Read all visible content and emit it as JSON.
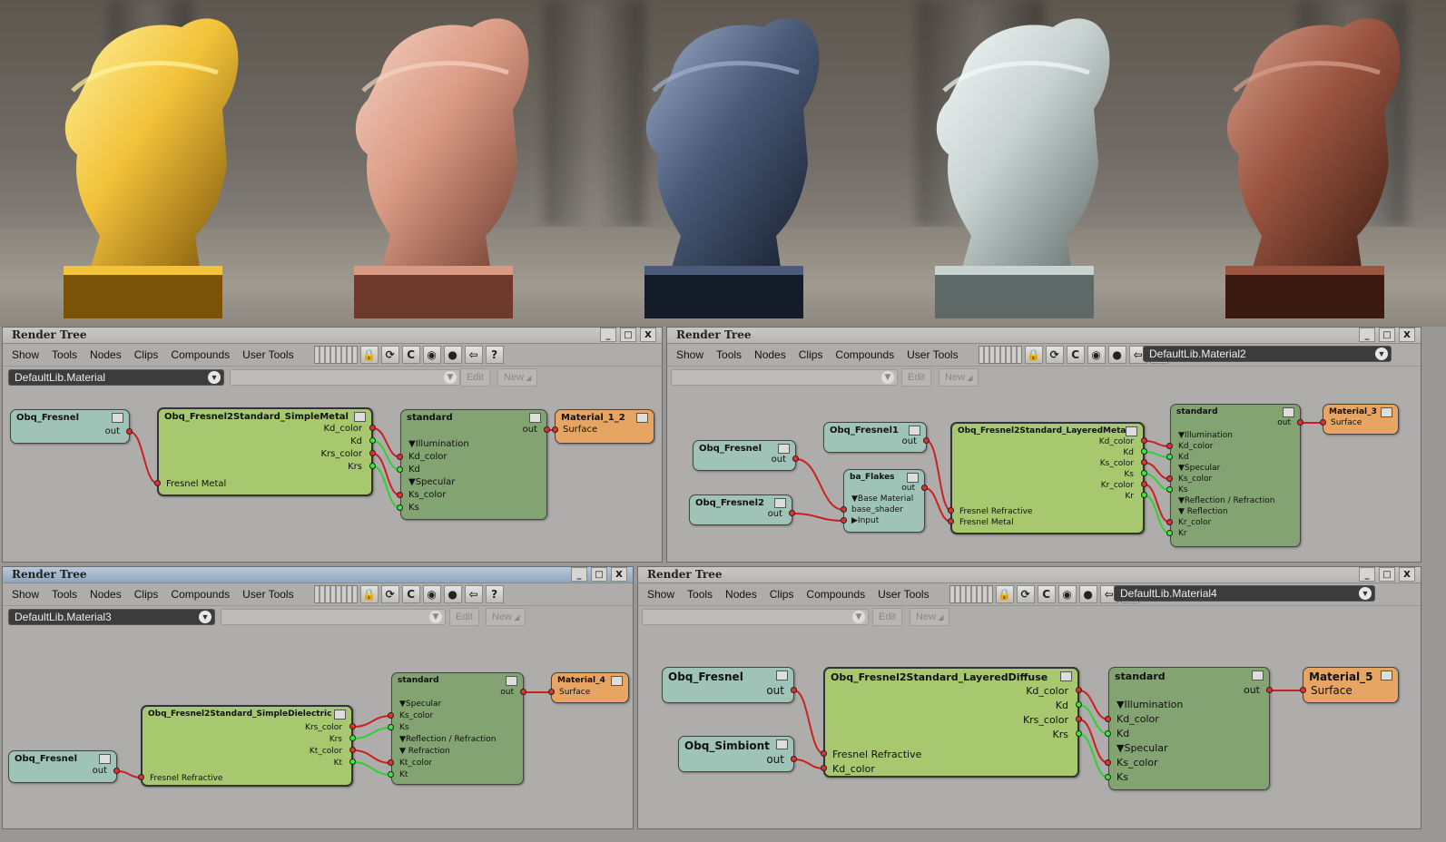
{
  "colors": {
    "gold": "#d4a020",
    "copper": "#c9806a",
    "steel": "#3c4a60",
    "glass": "#b8c2c0",
    "marble": "#8a4a38",
    "node_teal": "#9fc3b6",
    "node_green": "#a7c86f",
    "node_standard": "#83a373",
    "node_material": "#e7a563",
    "wire_red": "#cc2020",
    "wire_green": "#30d030"
  },
  "toolbar_icons": [
    "lock-icon",
    "refresh-icon",
    "c-icon",
    "globe-icon",
    "sphere-icon",
    "back-arrow-icon",
    "help-icon"
  ],
  "toolbar_glyphs": [
    "🔒",
    "⟳",
    "C",
    "◉",
    "●",
    "⇦",
    "?"
  ],
  "menus": [
    "Show",
    "Tools",
    "Nodes",
    "Clips",
    "Compounds",
    "User Tools"
  ],
  "edit_label": "Edit",
  "new_label": "New",
  "panels": [
    {
      "title": "Render Tree",
      "material": "DefaultLib.Material",
      "nodes": {
        "fresnel": {
          "title": "Obq_Fresnel",
          "out": "out"
        },
        "conv": {
          "title": "Obq_Fresnel2Standard_SimpleMetal",
          "ports_out": [
            "Kd_color",
            "Kd",
            "Krs_color",
            "Krs"
          ],
          "ports_in": [
            "Fresnel Metal"
          ]
        },
        "std": {
          "title": "standard",
          "out": "out",
          "ports": [
            "▼Illumination",
            "Kd_color",
            "Kd",
            "▼Specular",
            "Ks_color",
            "Ks"
          ]
        },
        "mat": {
          "title": "Material_1_2",
          "port": "Surface"
        }
      }
    },
    {
      "title": "Render Tree",
      "material": "DefaultLib.Material2",
      "nodes": {
        "fresnel1": {
          "title": "Obq_Fresnel1",
          "out": "out"
        },
        "fresnel": {
          "title": "Obq_Fresnel",
          "out": "out"
        },
        "fresnel2": {
          "title": "Obq_Fresnel2",
          "out": "out"
        },
        "flakes": {
          "title": "ba_Flakes",
          "out": "out",
          "ports": [
            "▼Base Material",
            "base_shader",
            "▶Input"
          ]
        },
        "conv": {
          "title": "Obq_Fresnel2Standard_LayeredMeta",
          "ports_out": [
            "Kd_color",
            "Kd",
            "Ks_color",
            "Ks",
            "Kr_color",
            "Kr"
          ],
          "ports_in": [
            "Fresnel Refractive",
            "Fresnel Metal"
          ]
        },
        "std": {
          "title": "standard",
          "out": "out",
          "ports": [
            "▼Illumination",
            "Kd_color",
            "Kd",
            "▼Specular",
            "Ks_color",
            "Ks",
            "▼Reflection / Refraction",
            "▼ Reflection",
            "Kr_color",
            "Kr"
          ]
        },
        "mat": {
          "title": "Material_3",
          "port": "Surface"
        }
      }
    },
    {
      "title": "Render Tree",
      "material": "DefaultLib.Material3",
      "nodes": {
        "fresnel": {
          "title": "Obq_Fresnel",
          "out": "out"
        },
        "conv": {
          "title": "Obq_Fresnel2Standard_SimpleDielectric",
          "ports_out": [
            "Krs_color",
            "Krs",
            "Kt_color",
            "Kt"
          ],
          "ports_in": [
            "Fresnel Refractive"
          ]
        },
        "std": {
          "title": "standard",
          "out": "out",
          "ports": [
            "▼Specular",
            "Ks_color",
            "Ks",
            "▼Reflection / Refraction",
            "▼ Refraction",
            "Kt_color",
            "Kt"
          ]
        },
        "mat": {
          "title": "Material_4",
          "port": "Surface"
        }
      }
    },
    {
      "title": "Render Tree",
      "material": "DefaultLib.Material4",
      "nodes": {
        "fresnel": {
          "title": "Obq_Fresnel",
          "out": "out"
        },
        "simbiont": {
          "title": "Obq_Simbiont",
          "out": "out"
        },
        "conv": {
          "title": "Obq_Fresnel2Standard_LayeredDiffuse",
          "ports_out": [
            "Kd_color",
            "Kd",
            "Krs_color",
            "Krs"
          ],
          "ports_in": [
            "Fresnel Refractive",
            "Kd_color"
          ]
        },
        "std": {
          "title": "standard",
          "out": "out",
          "ports": [
            "▼Illumination",
            "Kd_color",
            "Kd",
            "▼Specular",
            "Ks_color",
            "Ks"
          ]
        },
        "mat": {
          "title": "Material_5",
          "port": "Surface"
        }
      }
    }
  ]
}
